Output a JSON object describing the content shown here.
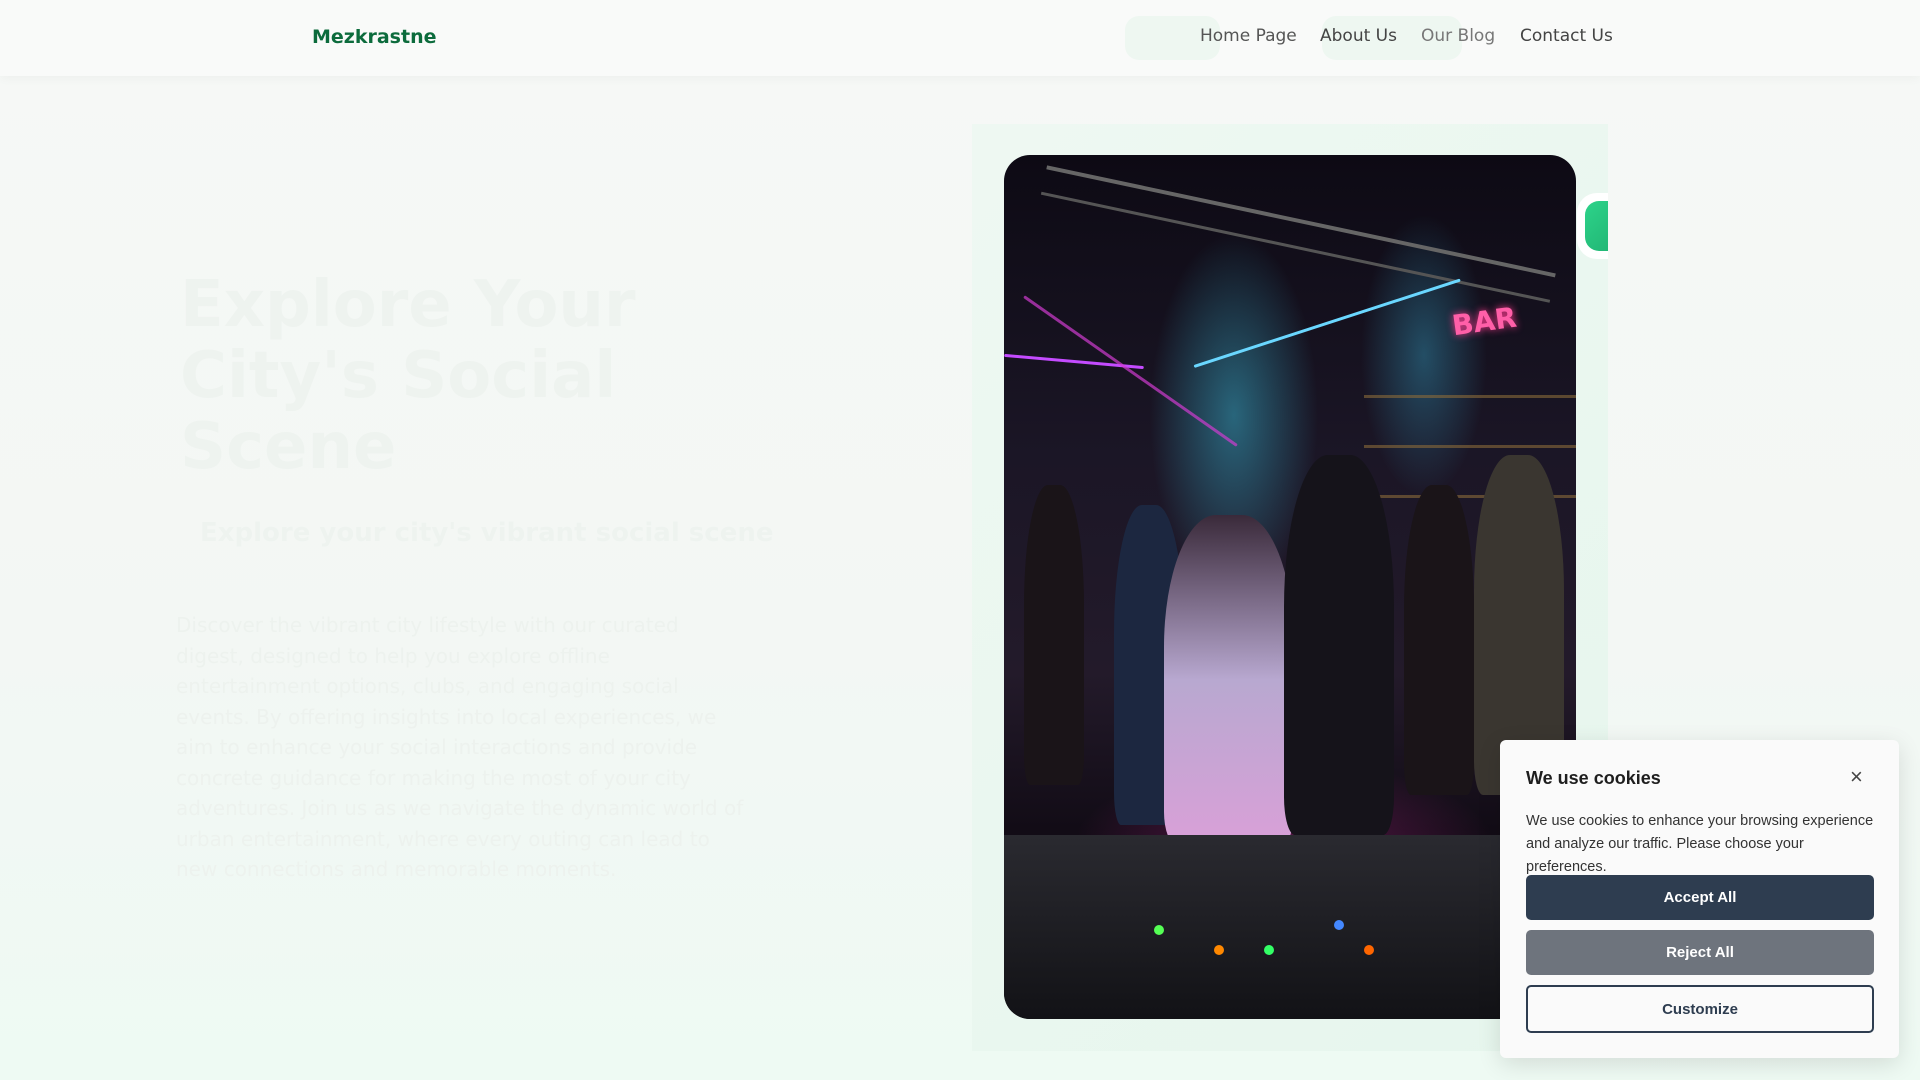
{
  "nav": {
    "logo": "Mezkrastne",
    "links": [
      "Home Page",
      "About Us",
      "Our Blog",
      "Contact Us"
    ]
  },
  "hero": {
    "title": "Explore Your City's Social Scene",
    "subtitle": "Explore your city's vibrant social scene",
    "body": "Discover the vibrant city lifestyle with our curated digest, designed to help you explore offline entertainment options, clubs, and engaging social events. By offering insights into local experiences, we aim to enhance your social interactions and provide concrete guidance for making the most of your city adventures. Join us as we navigate the dynamic world of urban entertainment, where every outing can lead to new connections and memorable moments.",
    "image_sign": "BAR"
  },
  "cookie": {
    "title": "We use cookies",
    "close": "×",
    "text": "We use cookies to enhance your browsing experience and analyze our traffic. Please choose your preferences.",
    "accept": "Accept All",
    "reject": "Reject All",
    "customize": "Customize"
  },
  "colors": {
    "brand": "#0c6b3c",
    "accept": "#2e3d50",
    "reject": "#6e747d"
  }
}
